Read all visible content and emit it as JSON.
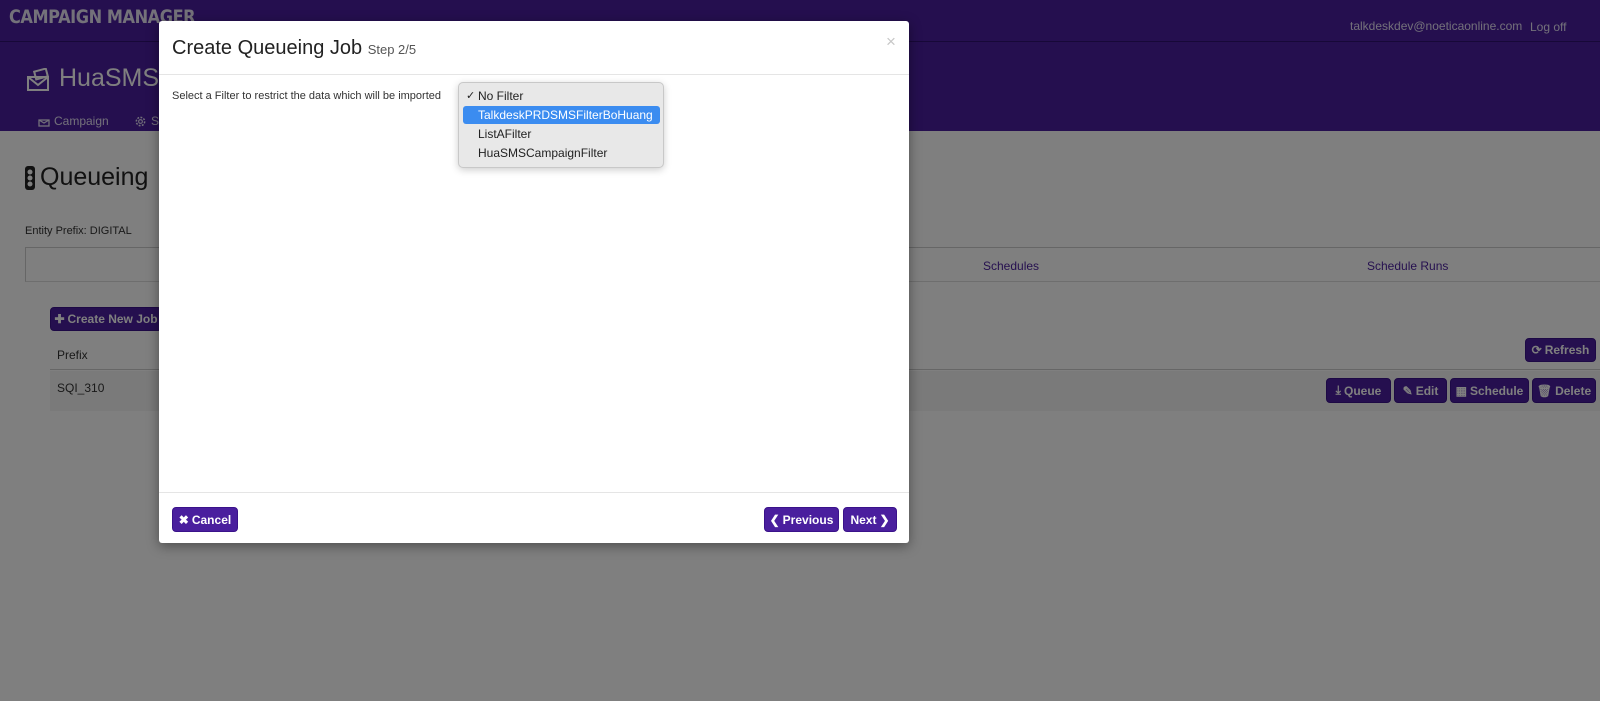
{
  "app": {
    "brand": "CAMPAIGN MANAGER",
    "user_email": "talkdeskdev@noeticaonline.com",
    "logoff": "Log off"
  },
  "campaign": {
    "name": "HuaSMS",
    "nav": [
      {
        "label": "Campaign",
        "icon": "campaign-icon"
      },
      {
        "label": "S",
        "icon": "gear-icon"
      }
    ]
  },
  "page": {
    "title": "Queueing",
    "title_icon": "traffic-light-icon",
    "entity_prefix": "Entity Prefix: DIGITAL",
    "tabs": [
      "Schedules",
      "Schedule Runs"
    ],
    "create_job_label": "Create New Job",
    "refresh_label": "Refresh"
  },
  "table": {
    "headers": [
      "Prefix"
    ],
    "rows": [
      {
        "prefix": "SQI_310"
      }
    ],
    "row_actions": [
      "Queue",
      "Edit",
      "Schedule",
      "Delete"
    ]
  },
  "modal": {
    "title": "Create Queueing Job",
    "step": "Step 2/5",
    "close": "×",
    "filter_label": "Select a Filter to restrict the data which will be imported",
    "filter_options": [
      {
        "label": "No Filter",
        "checked": true,
        "highlighted": false
      },
      {
        "label": "TalkdeskPRDSMSFilterBoHuang",
        "checked": false,
        "highlighted": true
      },
      {
        "label": "ListAFilter",
        "checked": false,
        "highlighted": false
      },
      {
        "label": "HuaSMSCampaignFilter",
        "checked": false,
        "highlighted": false
      }
    ],
    "cancel_label": "Cancel",
    "previous_label": "Previous",
    "next_label": "Next"
  },
  "colors": {
    "brand_purple": "#4a1f9e",
    "selection_blue": "#3b8cf0"
  }
}
